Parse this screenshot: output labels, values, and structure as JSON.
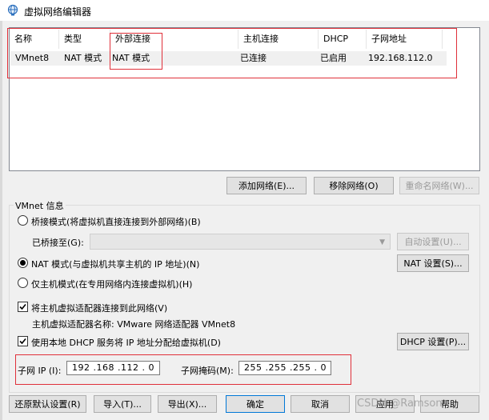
{
  "window": {
    "title": "虚拟网络编辑器",
    "icon": "globe-network-icon"
  },
  "network_table": {
    "columns": [
      "名称",
      "类型",
      "外部连接",
      "主机连接",
      "DHCP",
      "子网地址"
    ],
    "rows": [
      {
        "name": "VMnet8",
        "type": "NAT 模式",
        "external": "NAT 模式",
        "host": "已连接",
        "dhcp": "已启用",
        "subnet": "192.168.112.0"
      }
    ]
  },
  "table_buttons": {
    "add": "添加网络(E)...",
    "remove": "移除网络(O)",
    "rename": "重命名网络(W)..."
  },
  "vmnet_info": {
    "group_title": "VMnet 信息",
    "bridged_label": "桥接模式(将虚拟机直接连接到外部网络)(B)",
    "bridged_to_label": "已桥接至(G):",
    "bridged_to_value": "",
    "auto_settings": "自动设置(U)...",
    "nat_label": "NAT 模式(与虚拟机共享主机的 IP 地址)(N)",
    "nat_settings": "NAT 设置(S)...",
    "hostonly_label": "仅主机模式(在专用网络内连接虚拟机)(H)",
    "selected_mode": "nat",
    "connect_adapter_label": "将主机虚拟适配器连接到此网络(V)",
    "connect_adapter_checked": true,
    "adapter_name_label": "主机虚拟适配器名称: VMware 网络适配器 VMnet8",
    "use_dhcp_label": "使用本地 DHCP 服务将 IP 地址分配给虚拟机(D)",
    "use_dhcp_checked": true,
    "dhcp_settings": "DHCP 设置(P)...",
    "subnet_ip_label": "子网 IP (I):",
    "subnet_ip_value": "192 .168 .112 . 0",
    "subnet_mask_label": "子网掩码(M):",
    "subnet_mask_value": "255 .255 .255 . 0"
  },
  "footer_buttons": {
    "restore_defaults": "还原默认设置(R)",
    "import": "导入(T)...",
    "export": "导出(X)...",
    "ok": "确定",
    "cancel": "取消",
    "apply": "应用",
    "help": "帮助"
  },
  "watermark": "CSDN @Ramson",
  "colors": {
    "highlight_box": "#e0303a",
    "selected_row": "#f0f0f0",
    "dialog_bg": "#f0f0f0"
  }
}
